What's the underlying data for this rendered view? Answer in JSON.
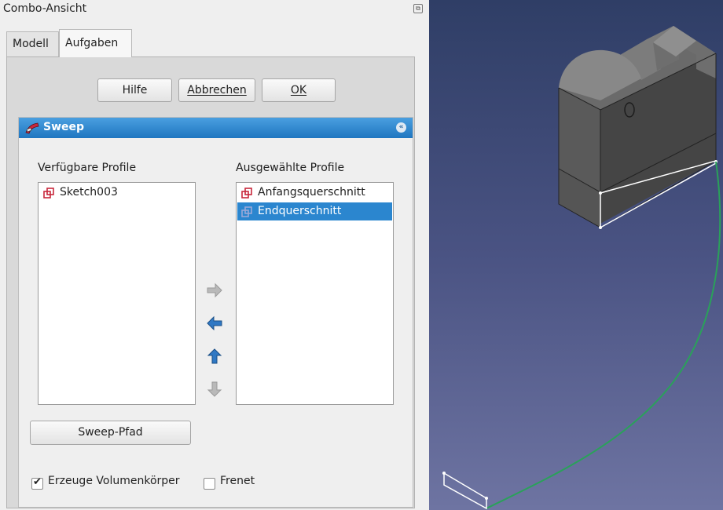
{
  "panel": {
    "title": "Combo-Ansicht",
    "tabs": [
      {
        "label": "Modell",
        "active": false
      },
      {
        "label": "Aufgaben",
        "active": true
      }
    ],
    "buttons": {
      "help": "Hilfe",
      "cancel": "Abbrechen",
      "ok": "OK"
    },
    "section": {
      "title": "Sweep",
      "available_label": "Verfügbare Profile",
      "selected_label": "Ausgewählte Profile",
      "available_items": [
        {
          "label": "Sketch003",
          "icon": "sketch-icon"
        }
      ],
      "selected_items": [
        {
          "label": "Anfangsquerschnitt",
          "icon": "sketch-icon",
          "selected": false
        },
        {
          "label": "Endquerschnitt",
          "icon": "sketch-icon",
          "selected": true
        }
      ],
      "arrow_buttons": [
        "arrow-right-icon",
        "arrow-left-icon",
        "arrow-up-icon",
        "arrow-down-icon"
      ],
      "sweep_path_button": "Sweep-Pfad",
      "checkboxes": [
        {
          "label": "Erzeuge Volumenkörper",
          "checked": true
        },
        {
          "label": "Frenet",
          "checked": false
        }
      ]
    }
  },
  "colors": {
    "header_blue": "#2b86cf",
    "selection_blue": "#2b86cf",
    "path_green": "#2aa15a",
    "viewport_top": "#2f3e66",
    "viewport_bottom": "#6e74a2"
  }
}
